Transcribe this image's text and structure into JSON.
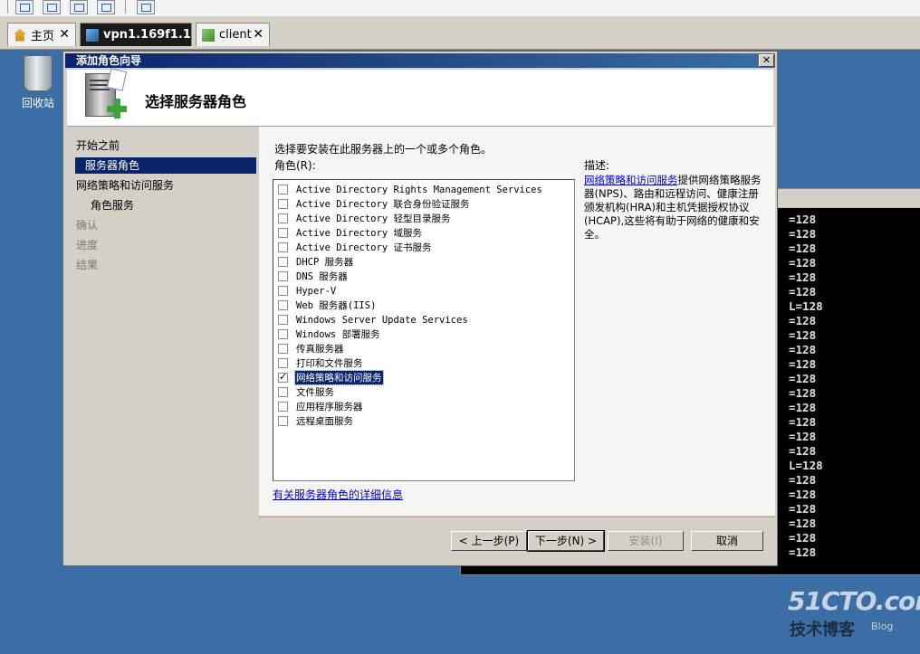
{
  "tabs": [
    {
      "label": "主页",
      "icon": "home-icon"
    },
    {
      "label": "vpn1.169f1.1",
      "icon": "vm-icon"
    },
    {
      "label": "client",
      "icon": "vm-icon"
    }
  ],
  "desktop": {
    "recycle_bin_label": "回收站",
    "console_lines": [
      "=128",
      "=128",
      "=128",
      "=128",
      "=128",
      "=128",
      "L=128",
      "=128",
      "=128",
      "=128",
      "=128",
      "=128",
      "=128",
      "=128",
      "=128",
      "=128",
      "=128",
      "L=128",
      "=128",
      "=128",
      "=128",
      "=128",
      "=128",
      "=128"
    ],
    "watermark": {
      "site": "51CTO.com",
      "tagline": "技术博客",
      "extra": "Blog"
    }
  },
  "dialog": {
    "title": "添加角色向导",
    "close_glyph": "✕",
    "header_title": "选择服务器角色",
    "nav": [
      {
        "label": "开始之前",
        "state": "normal"
      },
      {
        "label": "服务器角色",
        "state": "selected"
      },
      {
        "label": "网络策略和访问服务",
        "state": "normal"
      },
      {
        "label": "角色服务",
        "state": "sub"
      },
      {
        "label": "确认",
        "state": "dim"
      },
      {
        "label": "进度",
        "state": "dim"
      },
      {
        "label": "结果",
        "state": "dim"
      }
    ],
    "instruction": "选择要安装在此服务器上的一个或多个角色。",
    "roles_label": "角色(R):",
    "roles": [
      {
        "label": "Active Directory Rights Management Services",
        "checked": false
      },
      {
        "label": "Active Directory 联合身份验证服务",
        "checked": false
      },
      {
        "label": "Active Directory 轻型目录服务",
        "checked": false
      },
      {
        "label": "Active Directory 域服务",
        "checked": false
      },
      {
        "label": "Active Directory 证书服务",
        "checked": false
      },
      {
        "label": "DHCP 服务器",
        "checked": false
      },
      {
        "label": "DNS 服务器",
        "checked": false
      },
      {
        "label": "Hyper-V",
        "checked": false
      },
      {
        "label": "Web 服务器(IIS)",
        "checked": false
      },
      {
        "label": "Windows Server Update Services",
        "checked": false
      },
      {
        "label": "Windows 部署服务",
        "checked": false
      },
      {
        "label": "传真服务器",
        "checked": false
      },
      {
        "label": "打印和文件服务",
        "checked": false
      },
      {
        "label": "网络策略和访问服务",
        "checked": true,
        "selected": true
      },
      {
        "label": "文件服务",
        "checked": false
      },
      {
        "label": "应用程序服务器",
        "checked": false
      },
      {
        "label": "远程桌面服务",
        "checked": false
      }
    ],
    "description_label": "描述:",
    "description_link": "网络策略和访问服务",
    "description_text": "提供网络策略服务器(NPS)、路由和远程访问、健康注册颁发机构(HRA)和主机凭据授权协议(HCAP),这些将有助于网络的健康和安全。",
    "more_info_link": "有关服务器角色的详细信息",
    "buttons": {
      "back": "< 上一步(P)",
      "next": "下一步(N) >",
      "install": "安装(I)",
      "cancel": "取消"
    }
  }
}
